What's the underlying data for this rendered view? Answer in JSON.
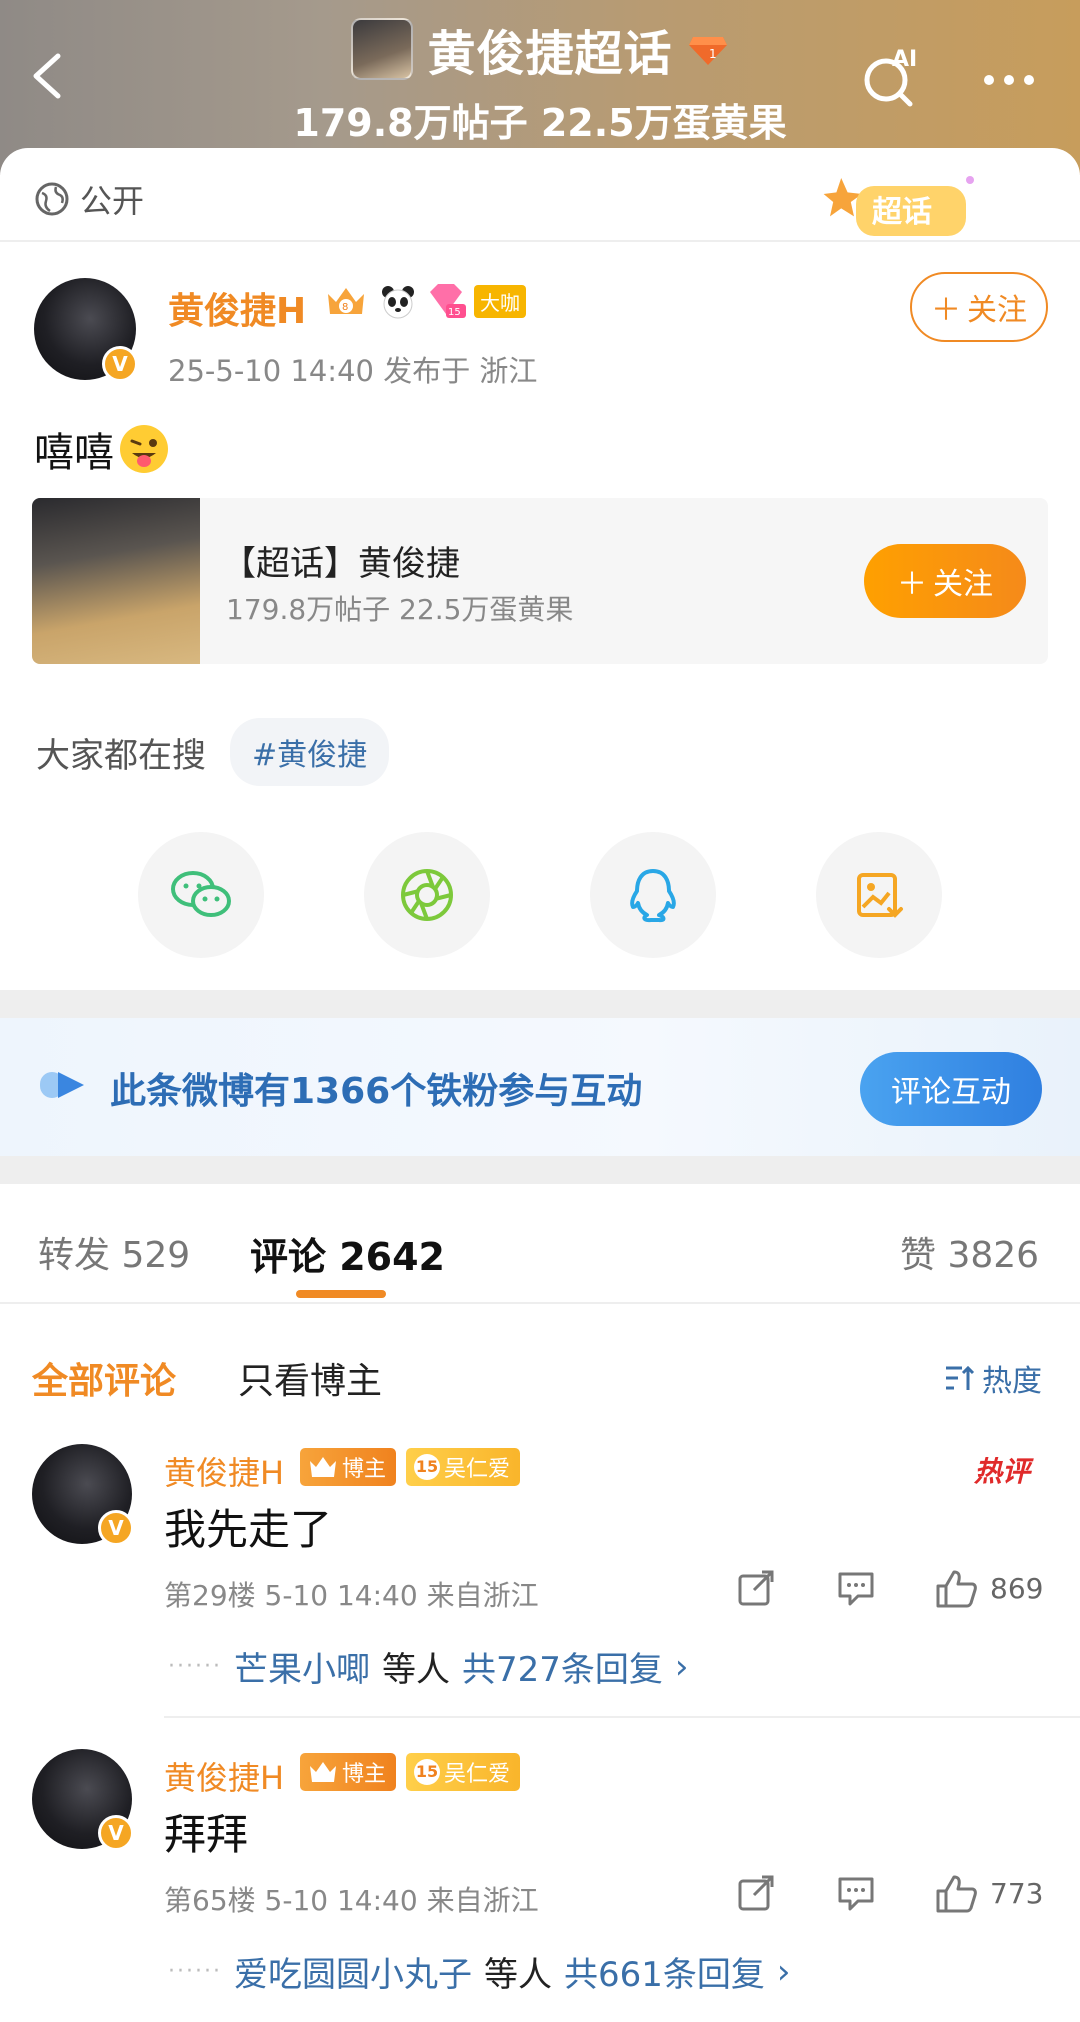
{
  "header": {
    "title": "黄俊捷超话",
    "stats": "179.8万帖子 22.5万蛋黄果",
    "ai_label": "AI"
  },
  "post": {
    "visibility": "公开",
    "sticker": "超话",
    "author": "黄俊捷H",
    "vip_label": "大咖",
    "meta": "25-5-10 14:40  发布于 浙江",
    "follow_label": "关注",
    "text": "嘻嘻",
    "topic": {
      "title": "【超话】黄俊捷",
      "stats": "179.8万帖子 22.5万蛋黄果",
      "follow_label": "关注"
    },
    "search": {
      "label": "大家都在搜",
      "chip": "#黄俊捷"
    },
    "share": [
      "wechat-icon",
      "moments-icon",
      "qq-icon",
      "save-image-icon"
    ]
  },
  "fans_banner": {
    "text": "此条微博有1366个铁粉参与互动",
    "button": "评论互动"
  },
  "tabs": {
    "repost": "转发 529",
    "comment": "评论 2642",
    "like": "赞 3826"
  },
  "filter": {
    "all": "全部评论",
    "owner_only": "只看博主",
    "sort": "热度"
  },
  "comments": [
    {
      "name": "黄俊捷H",
      "owner_badge": "博主",
      "fan_level": "15",
      "fan_badge": "吴仁爱",
      "hot": "热评",
      "text": "我先走了",
      "meta": "第29楼  5-10 14:40  来自浙江",
      "likes": "869",
      "reply_users": "芒果小唧",
      "reply_mid": "等人",
      "reply_total": "共727条回复"
    },
    {
      "name": "黄俊捷H",
      "owner_badge": "博主",
      "fan_level": "15",
      "fan_badge": "吴仁爱",
      "hot": "",
      "text": "拜拜",
      "meta": "第65楼  5-10 14:40  来自浙江",
      "likes": "773",
      "reply_users": "爱吃圆圆小丸子",
      "reply_mid": "等人",
      "reply_total": "共661条回复"
    }
  ],
  "colors": {
    "accent": "#f08a24",
    "link": "#3a6fa8",
    "fans_blue": "#2d6db5"
  }
}
